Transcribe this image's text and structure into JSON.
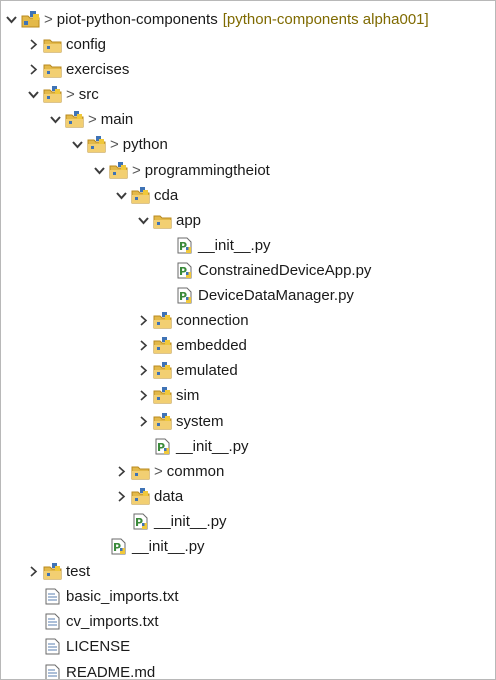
{
  "tree": {
    "project": {
      "dirty_marker": ">",
      "name": "piot-python-components",
      "decoration": "[python-components alpha001]"
    },
    "rows": [
      {
        "depth": 1,
        "twisty": "collapsed",
        "icon": "package-folder-icon",
        "dirty": "",
        "label": "config"
      },
      {
        "depth": 1,
        "twisty": "collapsed",
        "icon": "package-folder-icon",
        "dirty": "",
        "label": "exercises"
      },
      {
        "depth": 1,
        "twisty": "expanded",
        "icon": "python-package-icon",
        "dirty": ">",
        "label": "src"
      },
      {
        "depth": 2,
        "twisty": "expanded",
        "icon": "python-package-icon",
        "dirty": ">",
        "label": "main"
      },
      {
        "depth": 3,
        "twisty": "expanded",
        "icon": "python-package-icon",
        "dirty": ">",
        "label": "python"
      },
      {
        "depth": 4,
        "twisty": "expanded",
        "icon": "python-package-icon",
        "dirty": ">",
        "label": "programmingtheiot"
      },
      {
        "depth": 5,
        "twisty": "expanded",
        "icon": "python-package-icon",
        "dirty": "",
        "label": "cda"
      },
      {
        "depth": 6,
        "twisty": "expanded",
        "icon": "package-folder-icon",
        "dirty": "",
        "label": "app"
      },
      {
        "depth": 7,
        "twisty": "none",
        "icon": "python-file-icon",
        "dirty": "",
        "label": "__init__.py"
      },
      {
        "depth": 7,
        "twisty": "none",
        "icon": "python-file-icon",
        "dirty": "",
        "label": "ConstrainedDeviceApp.py"
      },
      {
        "depth": 7,
        "twisty": "none",
        "icon": "python-file-icon",
        "dirty": "",
        "label": "DeviceDataManager.py"
      },
      {
        "depth": 6,
        "twisty": "collapsed",
        "icon": "python-package-icon",
        "dirty": "",
        "label": "connection"
      },
      {
        "depth": 6,
        "twisty": "collapsed",
        "icon": "python-package-icon",
        "dirty": "",
        "label": "embedded"
      },
      {
        "depth": 6,
        "twisty": "collapsed",
        "icon": "python-package-icon",
        "dirty": "",
        "label": "emulated"
      },
      {
        "depth": 6,
        "twisty": "collapsed",
        "icon": "python-package-icon",
        "dirty": "",
        "label": "sim"
      },
      {
        "depth": 6,
        "twisty": "collapsed",
        "icon": "python-package-icon",
        "dirty": "",
        "label": "system"
      },
      {
        "depth": 6,
        "twisty": "none",
        "icon": "python-file-icon",
        "dirty": "",
        "label": "__init__.py"
      },
      {
        "depth": 5,
        "twisty": "collapsed",
        "icon": "package-folder-icon",
        "dirty": ">",
        "label": "common"
      },
      {
        "depth": 5,
        "twisty": "collapsed",
        "icon": "python-package-icon",
        "dirty": "",
        "label": "data"
      },
      {
        "depth": 5,
        "twisty": "none",
        "icon": "python-file-icon",
        "dirty": "",
        "label": "__init__.py"
      },
      {
        "depth": 4,
        "twisty": "none",
        "icon": "python-file-icon",
        "dirty": "",
        "label": "__init__.py"
      },
      {
        "depth": 1,
        "twisty": "collapsed",
        "icon": "python-package-icon",
        "dirty": "",
        "label": "test"
      },
      {
        "depth": 1,
        "twisty": "none",
        "icon": "text-file-icon",
        "dirty": "",
        "label": "basic_imports.txt"
      },
      {
        "depth": 1,
        "twisty": "none",
        "icon": "text-file-icon",
        "dirty": "",
        "label": "cv_imports.txt"
      },
      {
        "depth": 1,
        "twisty": "none",
        "icon": "text-file-icon",
        "dirty": "",
        "label": "LICENSE"
      },
      {
        "depth": 1,
        "twisty": "none",
        "icon": "text-file-icon",
        "dirty": "",
        "label": "README.md"
      }
    ]
  },
  "colors": {
    "folder": "#e3b94a",
    "folder_dark": "#b8891e",
    "python_badge_blue": "#3f73b5",
    "python_badge_yellow": "#f0c83a",
    "file_green": "#3a8a3a",
    "twisty": "#3c3c3c"
  }
}
